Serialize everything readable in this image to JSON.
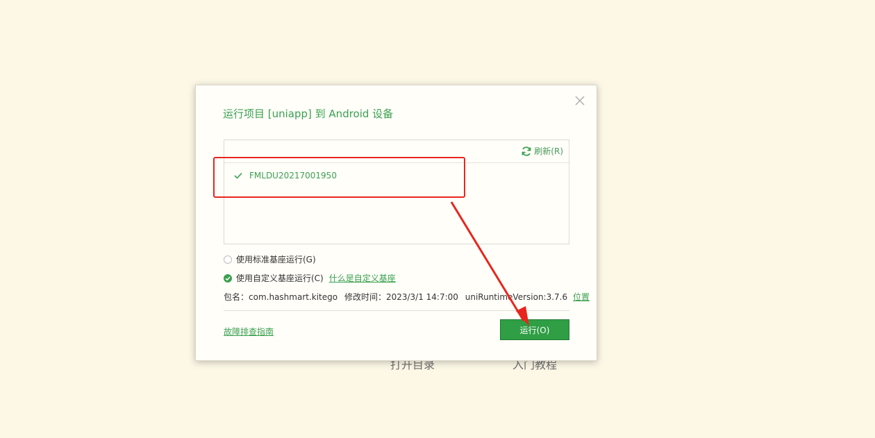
{
  "background": {
    "link_left": "打开目录",
    "link_right": "入门教程"
  },
  "dialog": {
    "title": "运行项目 [uniapp] 到 Android 设备",
    "close_icon": "close-icon",
    "refresh_label": "刷新(R)",
    "devices": [
      {
        "name": "FMLDU20217001950",
        "selected": true
      }
    ],
    "options": {
      "standard_label": "使用标准基座运行(G)",
      "standard_checked": false,
      "custom_label": "使用自定义基座运行(C)",
      "custom_checked": true,
      "custom_help_link": "什么是自定义基座"
    },
    "info": {
      "package_label": "包名：",
      "package_value": "com.hashmart.kitego",
      "modified_label": "修改时间：",
      "modified_value": "2023/3/1 14:7:00",
      "runtime_label": "uniRuntimeVersion:",
      "runtime_value": "3.7.6",
      "location_link": "位置"
    },
    "help_link": "故障排查指南",
    "run_button": "运行(O)"
  },
  "colors": {
    "accent": "#3aa04e",
    "button": "#2f9e44",
    "annotation": "#e8251c",
    "background": "#fdf8e6"
  }
}
